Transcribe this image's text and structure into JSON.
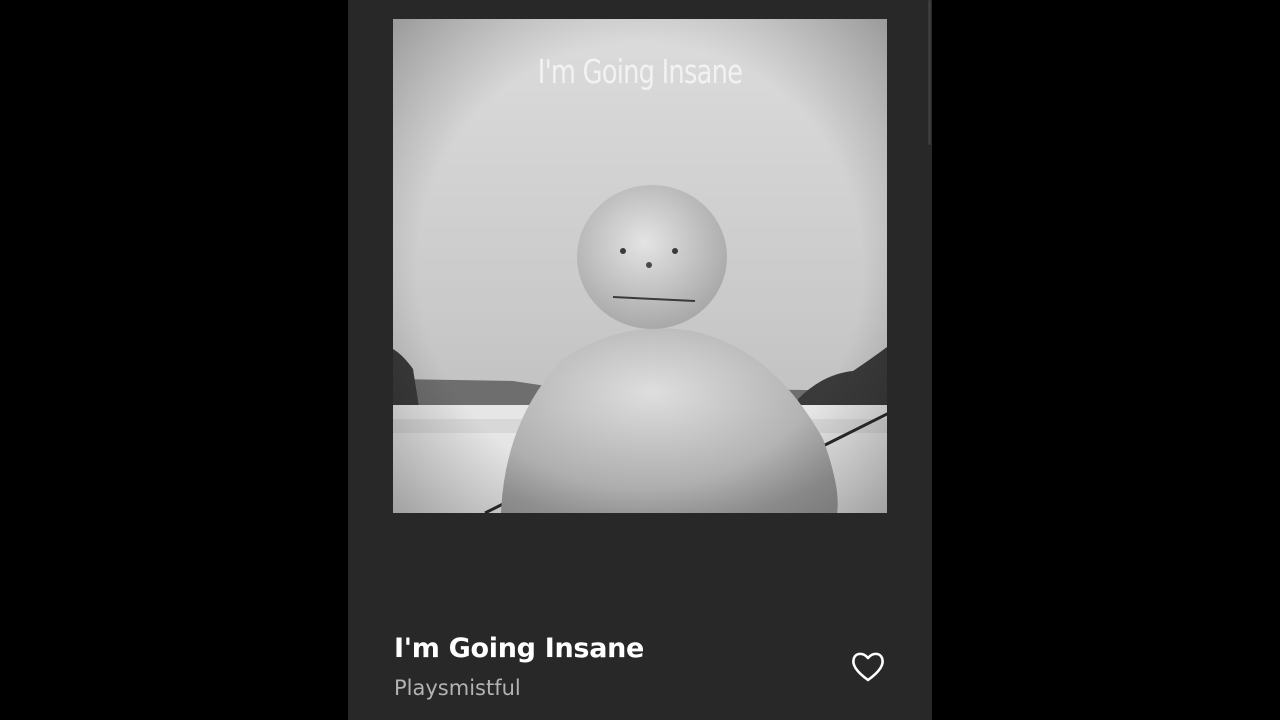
{
  "player": {
    "artwork": {
      "overlay_text": "I'm Going Insane",
      "description_icon": "album-art-snowman"
    },
    "track": {
      "title": "I'm Going Insane",
      "artist": "Playsmistful"
    },
    "like_icon": "heart-outline-icon"
  },
  "colors": {
    "background": "#000000",
    "panel": "#282828",
    "title": "#ffffff",
    "subtitle": "#b3b3b3"
  }
}
